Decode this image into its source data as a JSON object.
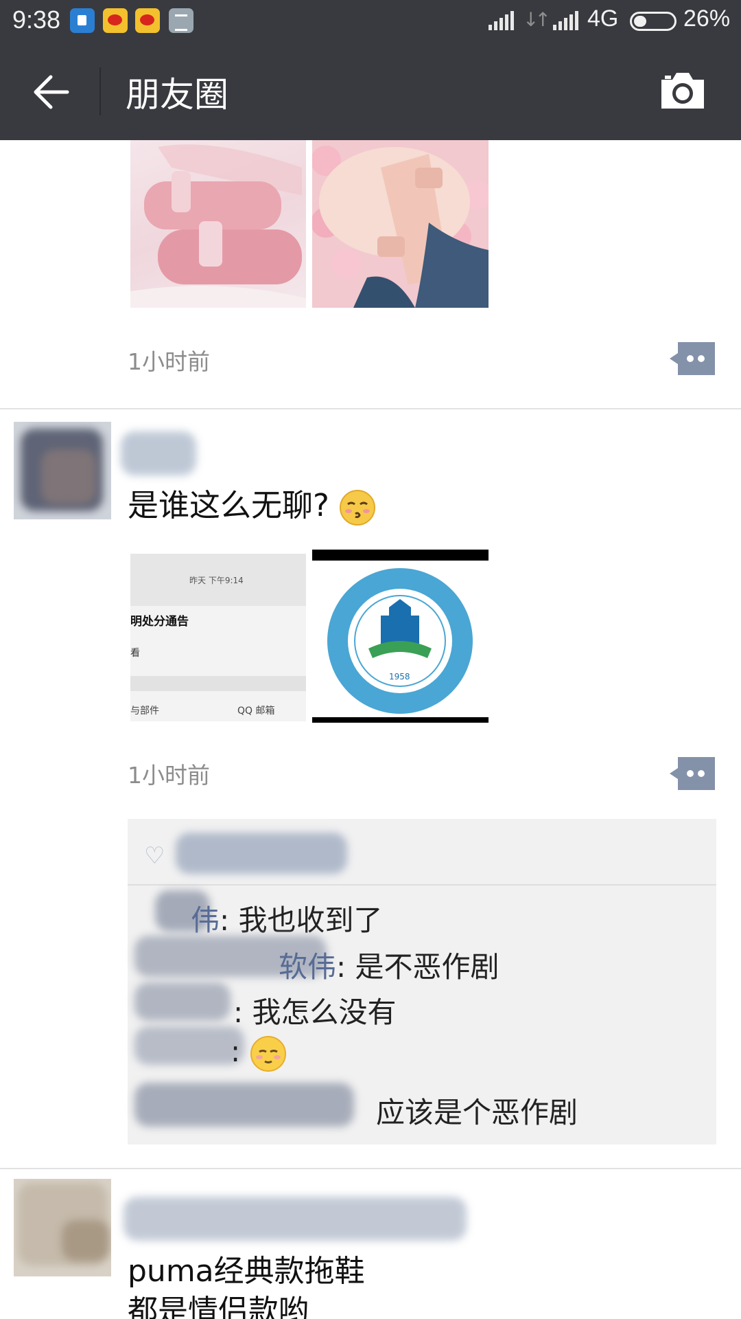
{
  "status_bar": {
    "time": "9:38",
    "network": "4G",
    "battery": "26%"
  },
  "nav": {
    "title": "朋友圈"
  },
  "posts": [
    {
      "time": "1小时前"
    },
    {
      "text": "是谁这么无聊?",
      "time": "1小时前",
      "screenshot_image": {
        "header": "昨天 下午9:14",
        "title": "明处分通告",
        "line1": "看",
        "footer_left": "与部件",
        "footer_right": "QQ 邮箱"
      },
      "logo_image": {
        "year": "1958"
      },
      "comments": [
        {
          "name_suffix": "伟",
          "text": ": 我也收到了"
        },
        {
          "name_suffix": "软伟",
          "text": ": 是不恶作剧"
        },
        {
          "name_suffix": "",
          "text": ": 我怎么没有"
        },
        {
          "name_suffix": "",
          "text": ":"
        },
        {
          "name_suffix": "",
          "text": "应该是个恶作剧"
        }
      ]
    },
    {
      "text_lines": [
        "puma经典款拖鞋",
        "都是情侣款哟"
      ]
    }
  ],
  "colors": {
    "bar": "#393a3f",
    "link": "#576b95",
    "comment_bg": "#f1f1f1"
  }
}
